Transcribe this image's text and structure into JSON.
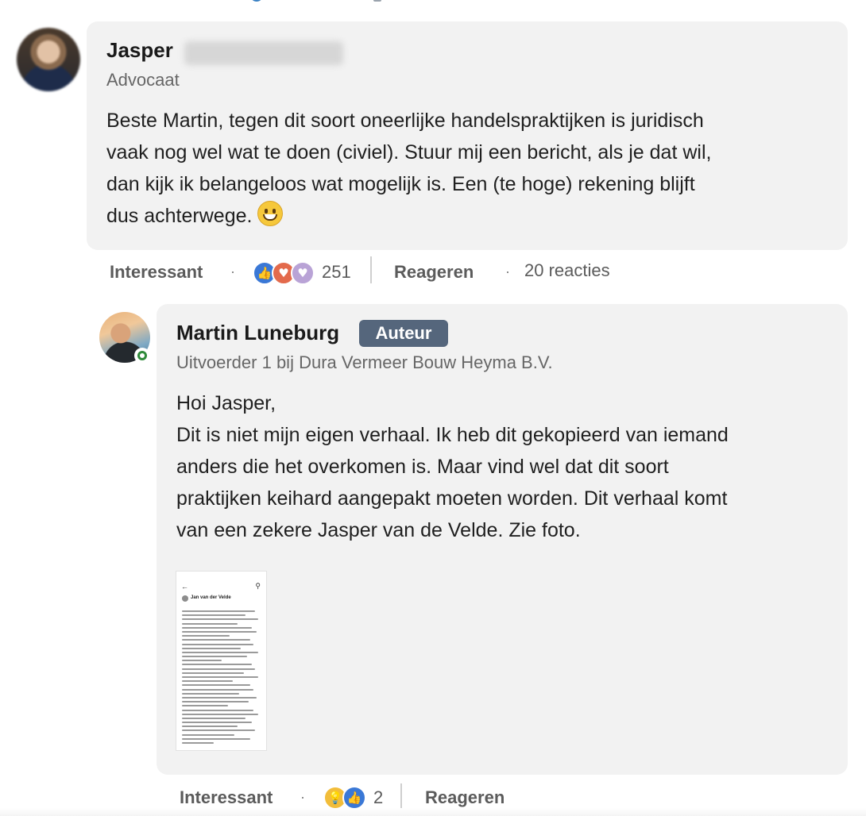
{
  "comment": {
    "author_first": "Jasper",
    "headline": "Advocaat",
    "text": "Beste Martin, tegen dit soort oneerlijke handelspraktijken is juridisch\nvaak nog wel wat te doen (civiel). Stuur mij een bericht, als je dat wil,\ndan kijk ik belangeloos wat mogelijk is. Een (te hoge) rekening blijft\ndus achterwege. ",
    "emoji": "grinning-face",
    "actions": {
      "interessant_label": "Interessant",
      "reaction_count": "251",
      "reply_label": "Reageren",
      "replies_label": "20 reacties",
      "reactions": [
        "like",
        "love",
        "support"
      ]
    }
  },
  "reply": {
    "author": "Martin Luneburg",
    "badge": "Auteur",
    "headline": "Uitvoerder 1 bij Dura Vermeer Bouw Heyma B.V.",
    "text": "Hoi Jasper,\nDit is niet mijn eigen verhaal. Ik heb dit gekopieerd van iemand\nanders die het overkomen is. Maar vind wel dat dit soort\npraktijken keihard aangepakt moeten worden. Dit verhaal komt\nvan een zekere Jasper van de Velde. Zie foto.",
    "attachment": {
      "poster_name": "Jan van der Velde"
    },
    "actions": {
      "interessant_label": "Interessant",
      "reaction_count": "2",
      "reply_label": "Reageren",
      "reactions": [
        "insightful",
        "like"
      ]
    }
  },
  "colors": {
    "bubble": "#f2f2f2",
    "badge": "#55667c",
    "online": "#2f8a3a"
  }
}
